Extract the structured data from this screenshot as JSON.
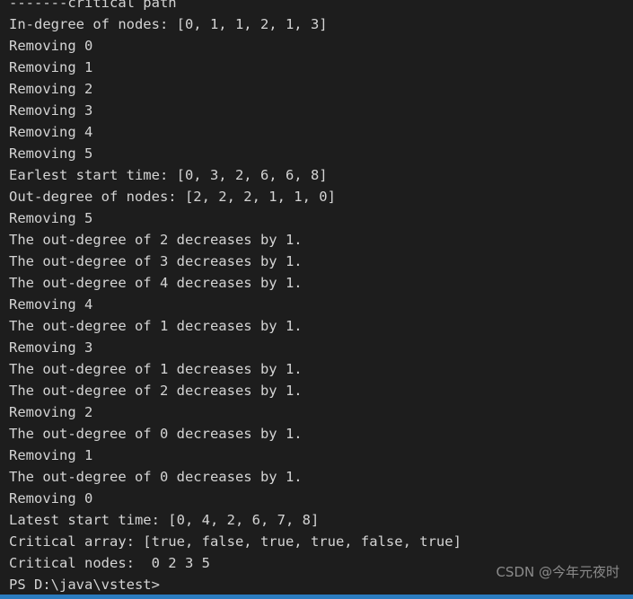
{
  "terminal": {
    "background_color": "#1d1d1d",
    "foreground_color": "#d4d4d4",
    "lines": [
      "-------critical path",
      "In-degree of nodes: [0, 1, 1, 2, 1, 3]",
      "Removing 0",
      "Removing 1",
      "Removing 2",
      "Removing 3",
      "Removing 4",
      "Removing 5",
      "Earlest start time: [0, 3, 2, 6, 6, 8]",
      "Out-degree of nodes: [2, 2, 2, 1, 1, 0]",
      "Removing 5",
      "The out-degree of 2 decreases by 1.",
      "The out-degree of 3 decreases by 1.",
      "The out-degree of 4 decreases by 1.",
      "Removing 4",
      "The out-degree of 1 decreases by 1.",
      "Removing 3",
      "The out-degree of 1 decreases by 1.",
      "The out-degree of 2 decreases by 1.",
      "Removing 2",
      "The out-degree of 0 decreases by 1.",
      "Removing 1",
      "The out-degree of 0 decreases by 1.",
      "Removing 0",
      "Latest start time: [0, 4, 2, 6, 7, 8]",
      "Critical array: [true, false, true, true, false, true]",
      "Critical nodes:  0 2 3 5"
    ],
    "prompt": "PS D:\\java\\vstest>"
  },
  "watermark": {
    "text": "CSDN @今年元夜时",
    "color": "#9a9a9a"
  },
  "statusbar": {
    "color": "#2b7cc0"
  }
}
